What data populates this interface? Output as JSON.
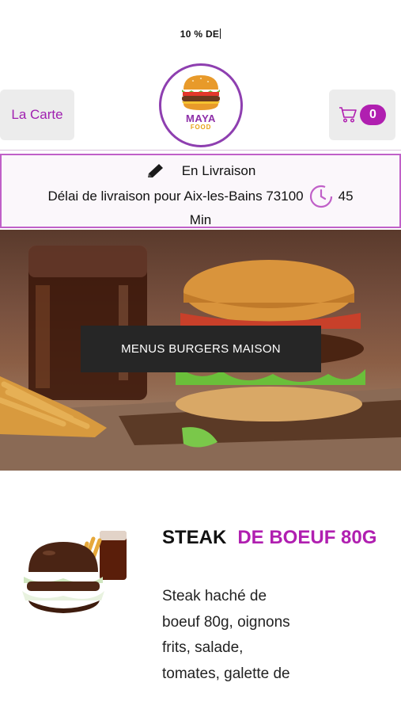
{
  "promo": {
    "text": "10 % DE"
  },
  "header": {
    "carte_label": "La Carte",
    "logo": {
      "brand": "MAYA",
      "sub": "FOOD"
    },
    "cart_count": "0"
  },
  "delivery": {
    "mode": "En Livraison",
    "delay_text": "Délai de livraison pour Aix-les-Bains 73100",
    "delay_value": "45",
    "delay_unit": "Min"
  },
  "hero": {
    "button_label": "MENUS BURGERS MAISON"
  },
  "product": {
    "title_part1": "STEAK",
    "title_part2": "DE BOEUF 80G",
    "description": "Steak haché de boeuf 80g, oignons frits, salade, tomates, galette de"
  },
  "colors": {
    "accent": "#b01fb0",
    "logo_ring": "#8e3fb0",
    "dark": "#262626"
  }
}
